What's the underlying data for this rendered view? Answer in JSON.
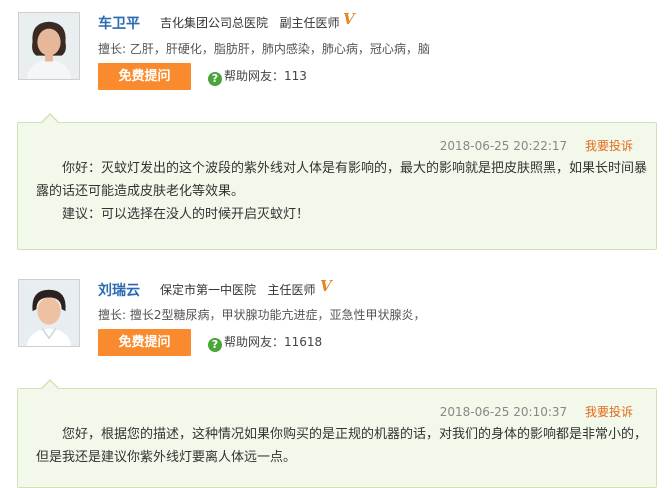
{
  "doctors": [
    {
      "name": "车卫平",
      "hospital": "吉化集团公司总医院",
      "title": "副主任医师",
      "verified_mark": "V",
      "skill": "擅长: 乙肝，肝硬化，脂肪肝，肺内感染，肺心病，冠心病，脑",
      "ask_label": "免费提问",
      "helped_label": "帮助网友：113",
      "reply": {
        "time": "2018-06-25 20:22:17",
        "report_label": "我要投诉",
        "text": "你好：灭蚊灯发出的这个波段的紫外线对人体是有影响的，最大的影响就是把皮肤照黑，如果长时间暴露的话还可能造成皮肤老化等效果。",
        "advice": "建议：可以选择在没人的时候开启灭蚊灯！"
      }
    },
    {
      "name": "刘瑞云",
      "hospital": "保定市第一中医院",
      "title": "主任医师",
      "verified_mark": "V",
      "skill": "擅长: 擅长2型糖尿病，甲状腺功能亢进症，亚急性甲状腺炎，",
      "ask_label": "免费提问",
      "helped_label": "帮助网友：11618",
      "reply": {
        "time": "2018-06-25 20:10:37",
        "report_label": "我要投诉",
        "text": "您好，根据您的描述，这种情况如果你购买的是正规的机器的话，对我们的身体的影响都是非常小的，但是我还是建议你紫外线灯要离人体远一点。"
      }
    }
  ],
  "colors": {
    "accent_orange": "#f98a2e",
    "name_blue": "#2a6ab0",
    "reply_bg": "#f2f8ea",
    "report_orange": "#e36a1b",
    "helped_icon_green": "#4aa53a"
  }
}
